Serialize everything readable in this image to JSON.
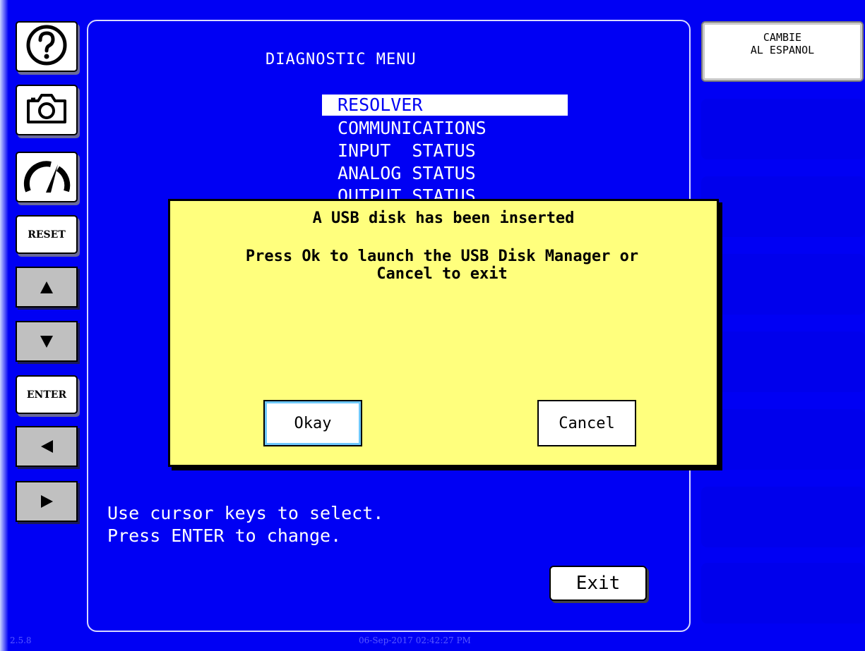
{
  "left_toolbar": {
    "help_icon": "help-icon",
    "camera_icon": "camera-icon",
    "gauge_icon": "gauge-icon",
    "reset_label": "RESET",
    "enter_label": "ENTER"
  },
  "language_button": {
    "line1": "CAMBIE",
    "line2": "AL ESPANOL"
  },
  "menu": {
    "title": "DIAGNOSTIC MENU",
    "items": [
      {
        "label": "RESOLVER",
        "selected": true
      },
      {
        "label": "COMMUNICATIONS",
        "selected": false
      },
      {
        "label": "INPUT  STATUS",
        "selected": false
      },
      {
        "label": "ANALOG STATUS",
        "selected": false
      },
      {
        "label": "OUTPUT STATUS",
        "selected": false
      }
    ]
  },
  "instructions": {
    "line1": "Use cursor keys to select.",
    "line2": "Press ENTER to change."
  },
  "exit_label": "Exit",
  "dialog": {
    "title": "A USB disk has been inserted",
    "message_line1": "Press Ok to launch the USB Disk Manager or",
    "message_line2": "Cancel to exit",
    "ok_label": "Okay",
    "cancel_label": "Cancel"
  },
  "footer": {
    "version": "2.5.8",
    "timestamp": "06-Sep-2017 02:42:27 PM"
  },
  "colors": {
    "background": "#0000f4",
    "dialog_background": "#ffff7d",
    "menu_highlight": "#ffffff"
  }
}
